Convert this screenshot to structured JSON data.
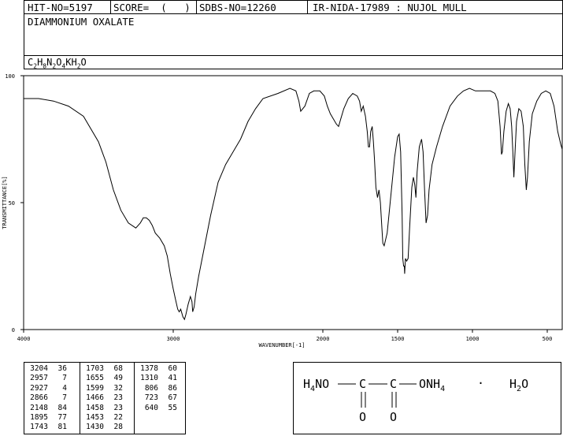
{
  "header": {
    "hit_no": "HIT-NO=5197",
    "score": "SCORE=  (   )",
    "sdbs_no": "SDBS-NO=12260",
    "ir_id": "IR-NIDA-17989 : NUJOL MULL"
  },
  "compound_name": "DIAMMONIUM OXALATE",
  "formula": {
    "parts": [
      "C",
      "2",
      "H",
      "8",
      "N",
      "2",
      "O",
      "4",
      "KH",
      "2",
      "O"
    ]
  },
  "chart_data": {
    "type": "line",
    "xlabel": "WAVENUMBER[-1]",
    "ylabel": "TRANSMITTANCE[%]",
    "xlim": [
      4000,
      400
    ],
    "ylim": [
      0,
      100
    ],
    "x_ticks": [
      4000,
      3000,
      2000,
      1500,
      1000,
      500
    ],
    "x_tick_labels": [
      "4000",
      "3000",
      "2000",
      "1500",
      "1000",
      "500"
    ],
    "y_ticks": [
      0,
      50,
      100
    ],
    "y_tick_labels": [
      "0",
      "50",
      "100"
    ],
    "series": [
      {
        "points": [
          [
            4000,
            91
          ],
          [
            3900,
            91
          ],
          [
            3800,
            90
          ],
          [
            3700,
            88
          ],
          [
            3600,
            84
          ],
          [
            3500,
            74
          ],
          [
            3450,
            66
          ],
          [
            3400,
            55
          ],
          [
            3350,
            47
          ],
          [
            3300,
            42
          ],
          [
            3250,
            40
          ],
          [
            3220,
            42
          ],
          [
            3200,
            44
          ],
          [
            3180,
            44
          ],
          [
            3160,
            43
          ],
          [
            3140,
            41
          ],
          [
            3120,
            38
          ],
          [
            3090,
            36
          ],
          [
            3060,
            33
          ],
          [
            3040,
            29
          ],
          [
            3020,
            22
          ],
          [
            3000,
            16
          ],
          [
            2985,
            12
          ],
          [
            2970,
            8
          ],
          [
            2960,
            7
          ],
          [
            2950,
            8
          ],
          [
            2935,
            5
          ],
          [
            2925,
            4
          ],
          [
            2915,
            6
          ],
          [
            2900,
            10
          ],
          [
            2885,
            13
          ],
          [
            2875,
            11
          ],
          [
            2870,
            7
          ],
          [
            2860,
            9
          ],
          [
            2850,
            14
          ],
          [
            2830,
            21
          ],
          [
            2800,
            30
          ],
          [
            2750,
            45
          ],
          [
            2700,
            58
          ],
          [
            2650,
            65
          ],
          [
            2600,
            70
          ],
          [
            2550,
            75
          ],
          [
            2500,
            82
          ],
          [
            2450,
            87
          ],
          [
            2400,
            91
          ],
          [
            2300,
            93
          ],
          [
            2220,
            95
          ],
          [
            2180,
            94
          ],
          [
            2160,
            90
          ],
          [
            2148,
            86
          ],
          [
            2120,
            88
          ],
          [
            2090,
            93
          ],
          [
            2060,
            94
          ],
          [
            2020,
            94
          ],
          [
            1990,
            92
          ],
          [
            1970,
            88
          ],
          [
            1950,
            85
          ],
          [
            1930,
            83
          ],
          [
            1910,
            81
          ],
          [
            1895,
            80
          ],
          [
            1880,
            83
          ],
          [
            1860,
            87
          ],
          [
            1830,
            91
          ],
          [
            1800,
            93
          ],
          [
            1770,
            92
          ],
          [
            1755,
            90
          ],
          [
            1743,
            86
          ],
          [
            1730,
            88
          ],
          [
            1715,
            84
          ],
          [
            1703,
            78
          ],
          [
            1695,
            72
          ],
          [
            1688,
            72
          ],
          [
            1680,
            78
          ],
          [
            1670,
            80
          ],
          [
            1662,
            74
          ],
          [
            1655,
            67
          ],
          [
            1645,
            56
          ],
          [
            1635,
            52
          ],
          [
            1625,
            55
          ],
          [
            1615,
            50
          ],
          [
            1605,
            40
          ],
          [
            1599,
            34
          ],
          [
            1590,
            33
          ],
          [
            1570,
            38
          ],
          [
            1550,
            50
          ],
          [
            1520,
            68
          ],
          [
            1500,
            76
          ],
          [
            1490,
            77
          ],
          [
            1480,
            70
          ],
          [
            1470,
            45
          ],
          [
            1466,
            28
          ],
          [
            1460,
            25
          ],
          [
            1455,
            25
          ],
          [
            1453,
            22
          ],
          [
            1448,
            28
          ],
          [
            1440,
            27
          ],
          [
            1430,
            28
          ],
          [
            1420,
            40
          ],
          [
            1405,
            56
          ],
          [
            1395,
            60
          ],
          [
            1385,
            57
          ],
          [
            1378,
            52
          ],
          [
            1370,
            62
          ],
          [
            1355,
            72
          ],
          [
            1340,
            75
          ],
          [
            1330,
            70
          ],
          [
            1320,
            55
          ],
          [
            1310,
            42
          ],
          [
            1300,
            45
          ],
          [
            1290,
            55
          ],
          [
            1270,
            65
          ],
          [
            1240,
            72
          ],
          [
            1200,
            80
          ],
          [
            1150,
            88
          ],
          [
            1100,
            92
          ],
          [
            1060,
            94
          ],
          [
            1020,
            95
          ],
          [
            980,
            94
          ],
          [
            930,
            94
          ],
          [
            880,
            94
          ],
          [
            850,
            93
          ],
          [
            830,
            90
          ],
          [
            815,
            80
          ],
          [
            806,
            69
          ],
          [
            800,
            70
          ],
          [
            790,
            78
          ],
          [
            775,
            86
          ],
          [
            760,
            89
          ],
          [
            748,
            87
          ],
          [
            738,
            80
          ],
          [
            730,
            70
          ],
          [
            723,
            60
          ],
          [
            715,
            70
          ],
          [
            705,
            82
          ],
          [
            690,
            87
          ],
          [
            675,
            86
          ],
          [
            660,
            80
          ],
          [
            650,
            65
          ],
          [
            640,
            55
          ],
          [
            632,
            60
          ],
          [
            620,
            74
          ],
          [
            600,
            85
          ],
          [
            570,
            90
          ],
          [
            540,
            93
          ],
          [
            510,
            94
          ],
          [
            480,
            93
          ],
          [
            455,
            88
          ],
          [
            430,
            78
          ],
          [
            410,
            73
          ],
          [
            400,
            71
          ]
        ]
      }
    ],
    "peak_table": [
      [
        3204,
        36
      ],
      [
        2957,
        7
      ],
      [
        2927,
        4
      ],
      [
        2866,
        7
      ],
      [
        2148,
        84
      ],
      [
        1895,
        77
      ],
      [
        1743,
        81
      ],
      [
        1703,
        68
      ],
      [
        1655,
        49
      ],
      [
        1599,
        32
      ],
      [
        1466,
        23
      ],
      [
        1458,
        23
      ],
      [
        1453,
        22
      ],
      [
        1430,
        28
      ],
      [
        1378,
        60
      ],
      [
        1310,
        41
      ],
      [
        806,
        86
      ],
      [
        723,
        67
      ],
      [
        640,
        55
      ]
    ]
  },
  "structure": {
    "left_group_parts": [
      "H",
      "4",
      "NO"
    ],
    "right_group_parts": [
      "ONH",
      "4"
    ],
    "carbon": "C",
    "oxygen": "O",
    "dot": "·",
    "water_parts": [
      "H",
      "2",
      "O"
    ]
  }
}
